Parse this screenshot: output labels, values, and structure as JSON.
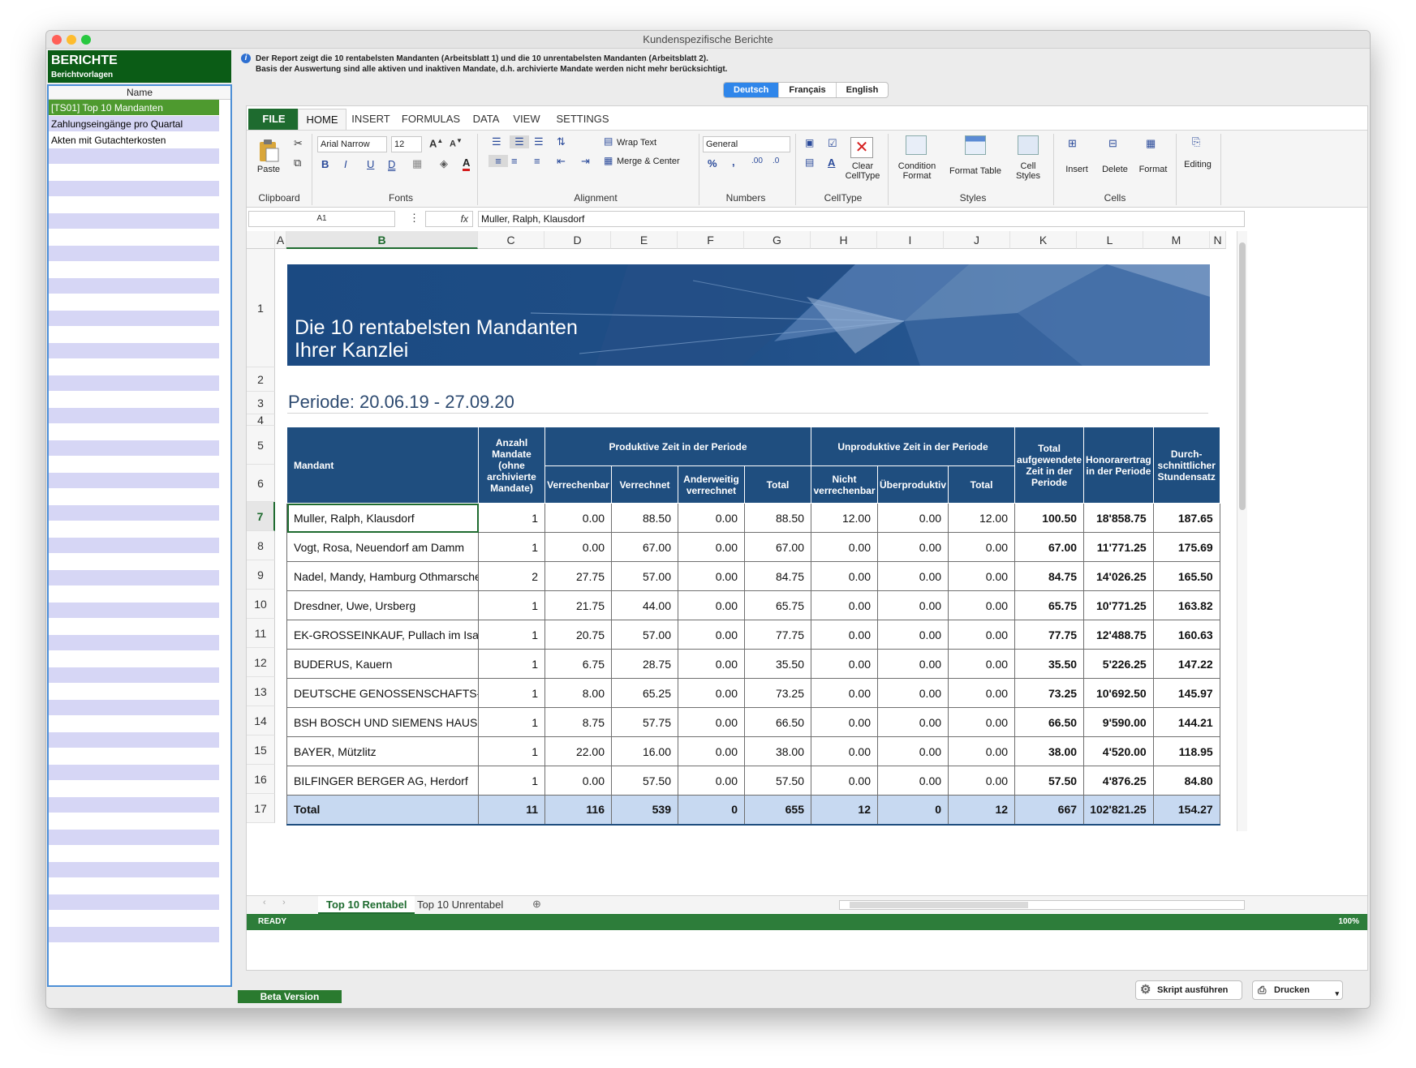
{
  "window": {
    "title": "Kundenspezifische Berichte",
    "colors": {
      "close": "#ff5f57",
      "minimize": "#febc2e",
      "zoom": "#28c840"
    }
  },
  "left_panel": {
    "title": "BERICHTE",
    "subtitle": "Berichtvorlagen",
    "column_header": "Name",
    "items": [
      {
        "label": "[TS01] Top 10 Mandanten",
        "selected": true
      },
      {
        "label": "Zahlungseingänge pro Quartal",
        "selected": false
      },
      {
        "label": "Akten mit Gutachterkosten",
        "selected": false
      }
    ]
  },
  "info": {
    "icon": "info-icon",
    "line1": "Der Report zeigt die 10 rentabelsten Mandanten (Arbeitsblatt 1) und die 10 unrentabelsten Mandanten (Arbeitsblatt 2).",
    "line2": "Basis der Auswertung sind alle aktiven und inaktiven Mandate, d.h. archivierte Mandate werden nicht mehr berücksichtigt."
  },
  "languages": {
    "active": "Deutsch",
    "items": [
      "Deutsch",
      "Français",
      "English"
    ]
  },
  "ribbon": {
    "file": "FILE",
    "tabs": [
      "HOME",
      "INSERT",
      "FORMULAS",
      "DATA",
      "VIEW",
      "SETTINGS"
    ],
    "active_tab": "HOME",
    "clipboard": {
      "paste": "Paste",
      "label": "Clipboard"
    },
    "fonts": {
      "family": "Arial Narrow",
      "size": "12",
      "label": "Fonts",
      "bold": "B",
      "italic": "I",
      "underline": "U",
      "double_underline": "D",
      "color_letter": "A"
    },
    "alignment": {
      "wrap": "Wrap Text",
      "merge": "Merge & Center",
      "label": "Alignment"
    },
    "numbers": {
      "format": "General",
      "percent": "%",
      "comma": ",",
      "label": "Numbers"
    },
    "celltype": {
      "clear_line1": "Clear",
      "clear_line2": "CellType",
      "label": "CellType"
    },
    "styles": {
      "cond_line1": "Condition",
      "cond_line2": "Format",
      "format_table": "Format Table",
      "cell_line1": "Cell",
      "cell_line2": "Styles",
      "label": "Styles"
    },
    "cells": {
      "insert": "Insert",
      "delete": "Delete",
      "format": "Format",
      "label": "Cells"
    },
    "editing": {
      "label": "Editing"
    },
    "accent": "#1e6b2f"
  },
  "formula_bar": {
    "cell": "A1",
    "fx": "fx",
    "value": "Muller, Ralph, Klausdorf"
  },
  "columns": [
    "A",
    "B",
    "C",
    "D",
    "E",
    "F",
    "G",
    "H",
    "I",
    "J",
    "K",
    "L",
    "M",
    "N"
  ],
  "rows": [
    "1",
    "2",
    "3",
    "4",
    "5",
    "6",
    "7",
    "8",
    "9",
    "10",
    "11",
    "12",
    "13",
    "14",
    "15",
    "16",
    "17"
  ],
  "report": {
    "title_line1": "Die 10 rentabelsten Mandanten",
    "title_line2": "Ihrer Kanzlei",
    "periode": "Periode: 20.06.19 - 27.09.20",
    "headers": {
      "mandant": "Mandant",
      "anzahl": "Anzahl Mandate (ohne archivierte Mandate)",
      "produktiv": "Produktive Zeit in der Periode",
      "unproduktiv": "Unproduktive Zeit in der Periode",
      "total_aufgewendet": "Total aufgewendete Zeit in der Periode",
      "honorar": "Honorarertrag in der Periode",
      "stundensatz": "Durch-schnittlicher Stundensatz",
      "verrechenbar": "Verrechenbar",
      "verrechnet": "Verrechnet",
      "anderweitig": "Anderweitig verrechnet",
      "total": "Total",
      "nicht_verrechenbar": "Nicht verrechenbar",
      "ueberproduktiv": "Überproduktiv",
      "total2": "Total"
    },
    "rows": [
      [
        "Muller, Ralph, Klausdorf",
        "1",
        "0.00",
        "88.50",
        "0.00",
        "88.50",
        "12.00",
        "0.00",
        "12.00",
        "100.50",
        "18'858.75",
        "187.65"
      ],
      [
        "Vogt, Rosa, Neuendorf am Damm",
        "1",
        "0.00",
        "67.00",
        "0.00",
        "67.00",
        "0.00",
        "0.00",
        "0.00",
        "67.00",
        "11'771.25",
        "175.69"
      ],
      [
        "Nadel, Mandy, Hamburg Othmarschen",
        "2",
        "27.75",
        "57.00",
        "0.00",
        "84.75",
        "0.00",
        "0.00",
        "0.00",
        "84.75",
        "14'026.25",
        "165.50"
      ],
      [
        "Dresdner, Uwe, Ursberg",
        "1",
        "21.75",
        "44.00",
        "0.00",
        "65.75",
        "0.00",
        "0.00",
        "0.00",
        "65.75",
        "10'771.25",
        "163.82"
      ],
      [
        "EK-GROSSEINKAUF, Pullach im Isartal",
        "1",
        "20.75",
        "57.00",
        "0.00",
        "77.75",
        "0.00",
        "0.00",
        "0.00",
        "77.75",
        "12'488.75",
        "160.63"
      ],
      [
        "BUDERUS, Kauern",
        "1",
        "6.75",
        "28.75",
        "0.00",
        "35.50",
        "0.00",
        "0.00",
        "0.00",
        "35.50",
        "5'226.25",
        "147.22"
      ],
      [
        "DEUTSCHE GENOSSENSCHAFTS-HYPO",
        "1",
        "8.00",
        "65.25",
        "0.00",
        "73.25",
        "0.00",
        "0.00",
        "0.00",
        "73.25",
        "10'692.50",
        "145.97"
      ],
      [
        "BSH BOSCH UND SIEMENS HAUSGERAI",
        "1",
        "8.75",
        "57.75",
        "0.00",
        "66.50",
        "0.00",
        "0.00",
        "0.00",
        "66.50",
        "9'590.00",
        "144.21"
      ],
      [
        "BAYER, Mützlitz",
        "1",
        "22.00",
        "16.00",
        "0.00",
        "38.00",
        "0.00",
        "0.00",
        "0.00",
        "38.00",
        "4'520.00",
        "118.95"
      ],
      [
        "BILFINGER BERGER AG, Herdorf",
        "1",
        "0.00",
        "57.50",
        "0.00",
        "57.50",
        "0.00",
        "0.00",
        "0.00",
        "57.50",
        "4'876.25",
        "84.80"
      ]
    ],
    "total": [
      "Total",
      "11",
      "116",
      "539",
      "0",
      "655",
      "12",
      "0",
      "12",
      "667",
      "102'821.25",
      "154.27"
    ]
  },
  "sheets": {
    "tabs": [
      "Top 10 Rentabel",
      "Top 10 Unrentabel"
    ],
    "active": "Top 10 Rentabel"
  },
  "status": {
    "state": "READY",
    "zoom": "100%"
  },
  "bottom": {
    "beta": "Beta Version",
    "run_script": "Skript ausführen",
    "print": "Drucken"
  }
}
